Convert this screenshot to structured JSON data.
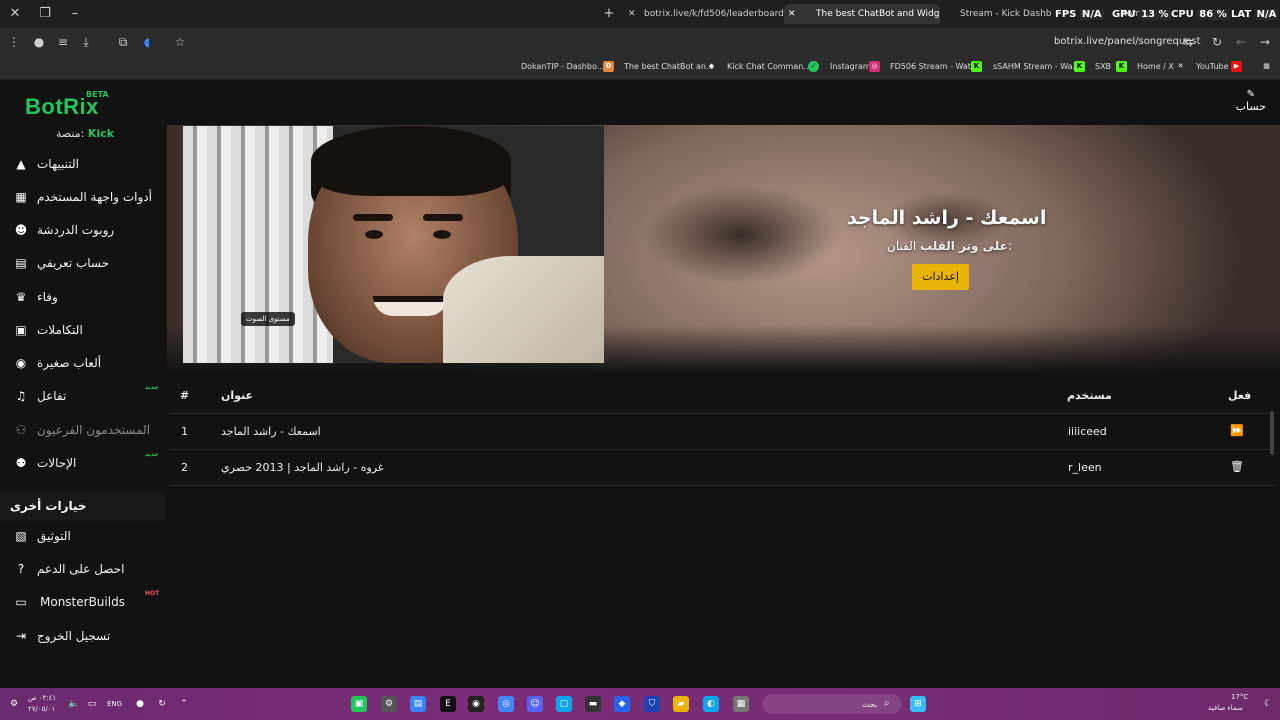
{
  "browser": {
    "tabs": [
      {
        "label": "botrix.live/k/fd506/leaderboard"
      },
      {
        "label": "The best ChatBot and Widg"
      },
      {
        "label": "Stream - Kick Dashboard"
      },
      {
        "label": "Home / X"
      }
    ],
    "hud": {
      "fps_label": "FPS",
      "fps_value": "N/A",
      "gpu_label": "GPU",
      "gpu_value": "13 %",
      "cpu_label": "CPU",
      "cpu_value": "86 %",
      "lat_label": "LAT",
      "lat_value": "N/A"
    },
    "url": "botrix.live/panel/songrequest",
    "bookmarks": [
      {
        "label": "DokanTIP - Dashbo..."
      },
      {
        "label": "The best ChatBot an..."
      },
      {
        "label": "Kick Chat Comman..."
      },
      {
        "label": "Instagram"
      },
      {
        "label": "FD506 Stream - Wat..."
      },
      {
        "label": "sSAHM Stream - Wa..."
      },
      {
        "label": "SXB"
      },
      {
        "label": "Home / X"
      },
      {
        "label": "YouTube"
      }
    ]
  },
  "app": {
    "logo": "BotRix",
    "beta": "BETA",
    "account": "حساب",
    "platform_label": "منصة:",
    "platform_value": "Kick"
  },
  "sidebar": {
    "items": [
      {
        "label": "التنبيهات",
        "icon": "warning-icon"
      },
      {
        "label": "أدوات واجهة المستخدم",
        "icon": "widgets-icon"
      },
      {
        "label": "روبوت الدردشة",
        "icon": "robot-icon"
      },
      {
        "label": "حساب تعريفي",
        "icon": "profile-card-icon"
      },
      {
        "label": "وفاء",
        "icon": "trophy-icon"
      },
      {
        "label": "التكاملات",
        "icon": "integrations-icon"
      },
      {
        "label": "ألعاب صغيرة",
        "icon": "gamepad-icon"
      },
      {
        "label": "تفاعل",
        "icon": "music-icon",
        "tag": "جديد"
      },
      {
        "label": "المستخدمون الفرعيون",
        "icon": "users-icon"
      },
      {
        "label": "الإحالات",
        "icon": "referrals-icon",
        "tag": "جديد"
      }
    ],
    "section_title": "خيارات أخرى",
    "other": [
      {
        "label": "التوثيق",
        "icon": "docs-icon"
      },
      {
        "label": "احصل على الدعم",
        "icon": "help-icon"
      },
      {
        "label": "MonsterBuilds",
        "icon": "laptop-icon",
        "tag": "HOT"
      },
      {
        "label": "تسجيل الخروج",
        "icon": "logout-icon"
      }
    ]
  },
  "player": {
    "title": "اسمعك - راشد الماجد",
    "artist_label": "الفنان:",
    "artist_value": "على وتر القلب",
    "settings_button": "إعدادات",
    "volume_tooltip": "مستوى الصوت"
  },
  "queue": {
    "headers": {
      "index": "#",
      "title": "عنوان",
      "user": "مستخدم",
      "action": "فعل"
    },
    "rows": [
      {
        "index": "1",
        "title": "اسمعك - راشد الماجد",
        "user": "iiiiceed",
        "action_icon": "skip-icon"
      },
      {
        "index": "2",
        "title": "غروه - راشد الماجد | 2013 حصري",
        "user": "r_leen",
        "action_icon": "trash-icon"
      }
    ]
  },
  "taskbar": {
    "time": "٠٣:٤١ ص",
    "date": "٢٧/٠٥/٠١",
    "lang": "ENG",
    "search_placeholder": "بحث",
    "weather_temp": "17°C",
    "weather_desc": "سماء صافية"
  },
  "colors": {
    "accent": "#22c55e",
    "button": "#eab308",
    "taskbar": "#7b2c78"
  }
}
